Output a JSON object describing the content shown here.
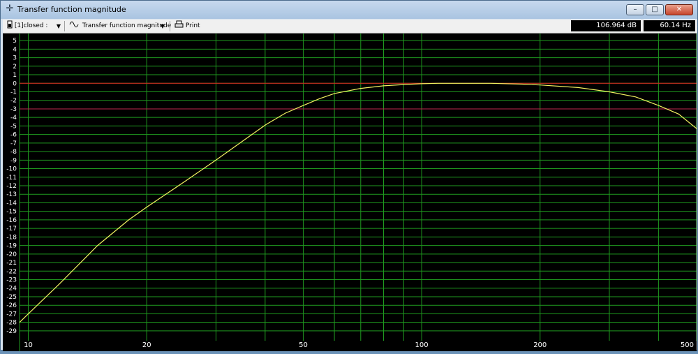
{
  "window": {
    "title": "Transfer function magnitude",
    "title_icon": "crosshair-icon",
    "controls": {
      "minimize": "–",
      "maximize": "□",
      "close": "✕"
    }
  },
  "toolbar": {
    "source_label": "[1]closed :",
    "mode_label": "Transfer function magnitude",
    "print_label": "Print",
    "readout_level": "106.964 dB",
    "readout_freq": "60.14 Hz"
  },
  "colors": {
    "background": "#000000",
    "grid": "#1f9a1f",
    "axis_text": "#ffffff",
    "curve": "#f0f060",
    "ref_0db": "#e02020",
    "ref_m3db": "#c02850"
  },
  "chart_data": {
    "type": "line",
    "x_scale": "log",
    "xlim": [
      9.5,
      500
    ],
    "ylim": [
      -29.5,
      5.5
    ],
    "x_tick_labels": [
      10,
      20,
      50,
      100,
      200,
      500
    ],
    "x_grid": [
      10,
      20,
      30,
      40,
      50,
      60,
      70,
      80,
      90,
      100,
      200,
      300,
      400,
      500
    ],
    "y_ticks": [
      5,
      4,
      3,
      2,
      1,
      0,
      -1,
      -2,
      -3,
      -4,
      -5,
      -6,
      -7,
      -8,
      -9,
      -10,
      -11,
      -12,
      -13,
      -14,
      -15,
      -16,
      -17,
      -18,
      -19,
      -20,
      -21,
      -22,
      -23,
      -24,
      -25,
      -26,
      -27,
      -28,
      -29
    ],
    "y_tick_labels": [
      "5",
      "4",
      "3",
      "2",
      "1",
      "0",
      "-1",
      "-2",
      "-3",
      "-4",
      "-5",
      "-6",
      "-7",
      "-8",
      "-9",
      "-10",
      "-11",
      "-12",
      "-13",
      "-14",
      "-15",
      "-16",
      "-17",
      "-18",
      "-19",
      "-20",
      "-21",
      "-22",
      "-23",
      "-24",
      "-25",
      "-26",
      "-27",
      "-28",
      "-29"
    ],
    "reference_lines": [
      0,
      -3
    ],
    "series": [
      {
        "x": [
          9.5,
          10,
          12,
          15,
          18,
          20,
          25,
          30,
          35,
          40,
          45,
          50,
          55,
          60,
          70,
          80,
          90,
          100,
          110,
          120,
          150,
          180,
          200,
          250,
          300,
          350,
          400,
          450,
          500
        ],
        "y": [
          -28.0,
          -27.0,
          -23.5,
          -19.0,
          -16.0,
          -14.5,
          -11.5,
          -9.0,
          -6.8,
          -4.9,
          -3.5,
          -2.6,
          -1.8,
          -1.2,
          -0.6,
          -0.3,
          -0.15,
          -0.05,
          0.0,
          0.0,
          0.0,
          -0.1,
          -0.2,
          -0.5,
          -1.0,
          -1.6,
          -2.6,
          -3.6,
          -5.3
        ]
      }
    ]
  }
}
